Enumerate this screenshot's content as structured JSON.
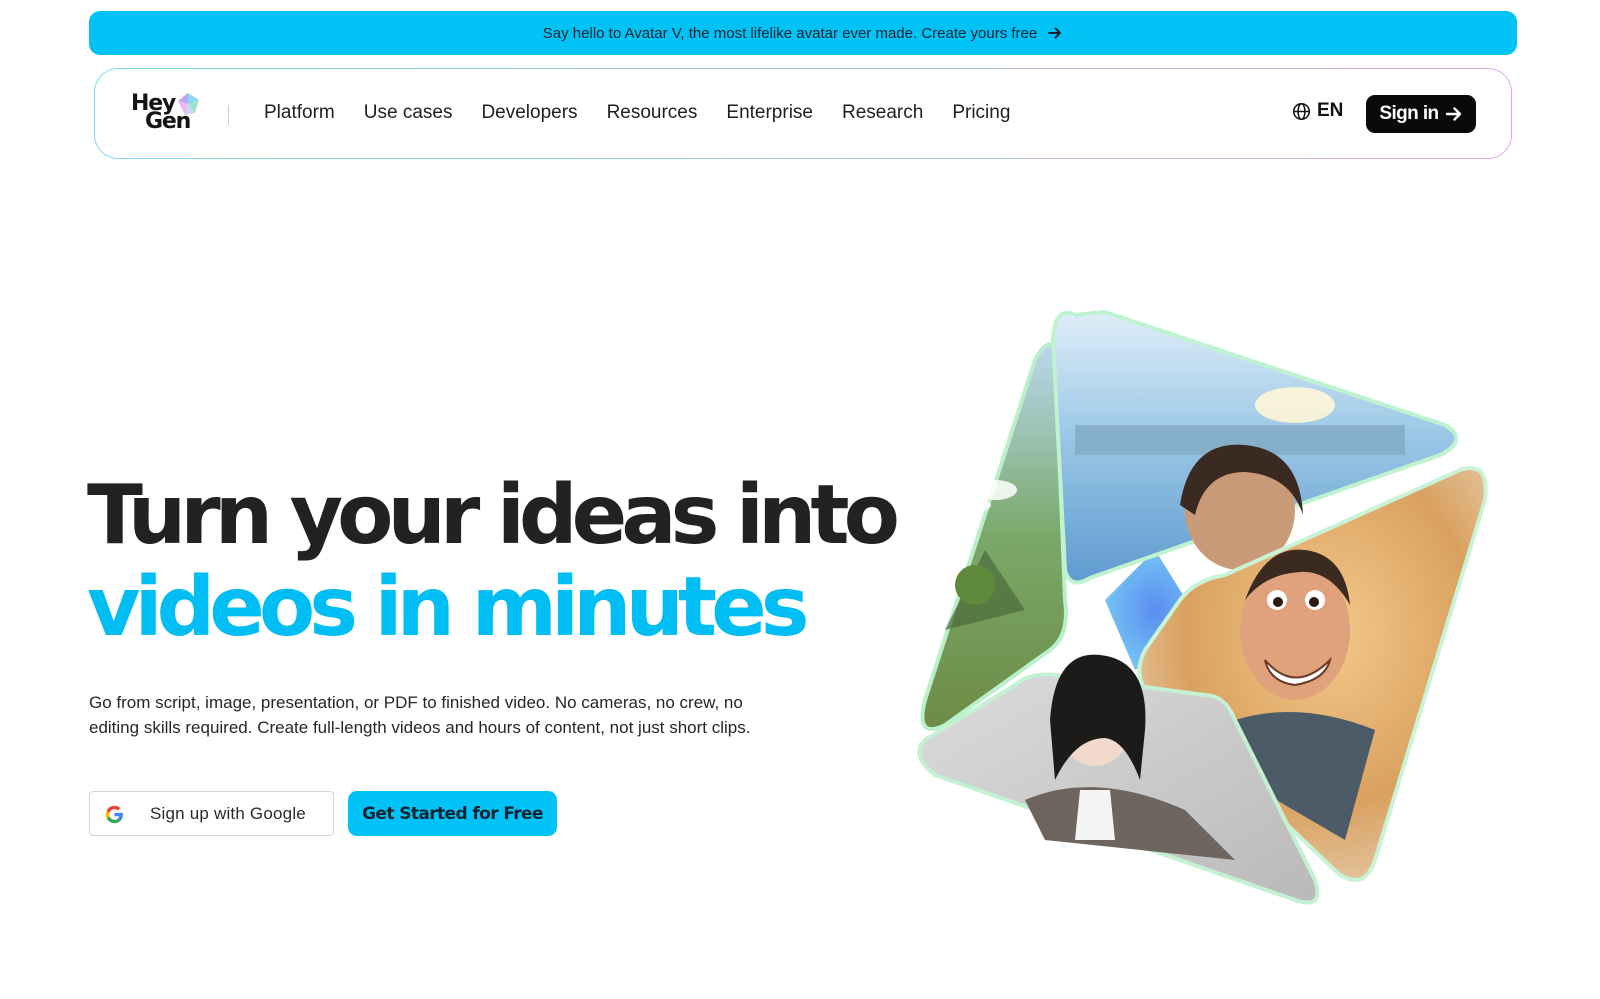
{
  "banner": {
    "text": "Say hello to Avatar V, the most lifelike avatar ever made. Create yours free",
    "icon": "arrow-right-icon"
  },
  "nav": {
    "logo": {
      "line1": "Hey",
      "line2": "Gen"
    },
    "items": [
      {
        "label": "Platform"
      },
      {
        "label": "Use cases"
      },
      {
        "label": "Developers"
      },
      {
        "label": "Resources"
      },
      {
        "label": "Enterprise"
      },
      {
        "label": "Research"
      },
      {
        "label": "Pricing"
      }
    ],
    "language": {
      "label": "EN",
      "icon": "globe-icon"
    },
    "signin": {
      "label": "Sign in",
      "icon": "arrow-right-icon"
    }
  },
  "hero": {
    "headline_line1": "Turn your ideas into",
    "headline_line2": "videos in minutes",
    "description": "Go from script, image, presentation, or PDF to finished video. No cameras, no crew, no editing skills required. Create full-length videos and hours of content, not just short clips.",
    "google_button": {
      "label": "Sign up with Google",
      "icon": "google-icon"
    },
    "cta_button": {
      "label": "Get Started for Free"
    }
  },
  "colors": {
    "accent": "#00c2f5",
    "headline_dark": "#222222",
    "headline_blue": "#00bdf3",
    "signin_bg": "#0a0a0a"
  }
}
